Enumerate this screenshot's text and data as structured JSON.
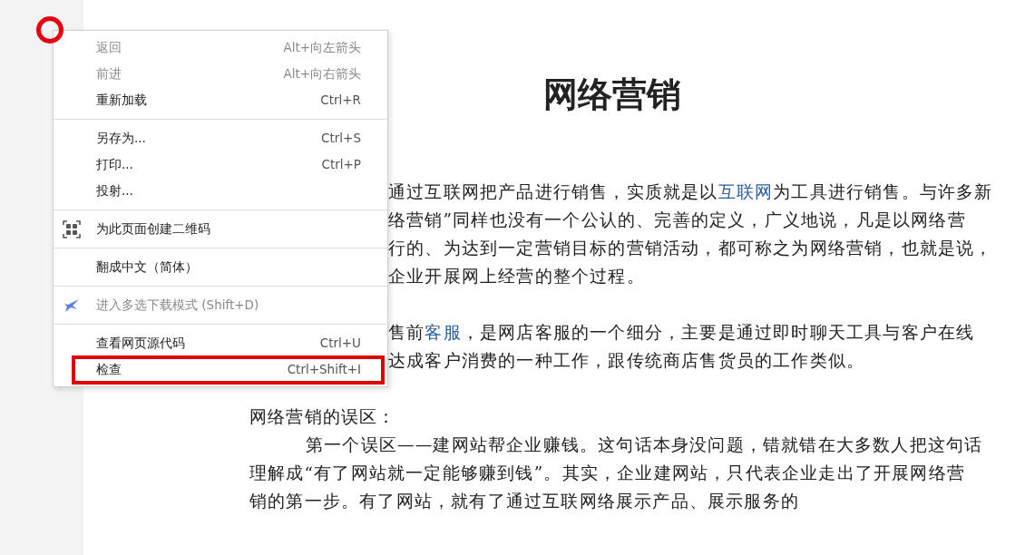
{
  "article": {
    "title": "网络营销",
    "lines": [
      {
        "kind": "clipped",
        "segments": [
          {
            "text": "通过互联网把产品进行销售，实质就是以",
            "link": false
          },
          {
            "text": "互联网",
            "link": true
          },
          {
            "text": "为工具进行销售。与许多新",
            "link": false
          }
        ]
      },
      {
        "kind": "clipped",
        "segments": [
          {
            "text": "络营销”同样也没有一个公认的、完善的定义，广义地说，凡是以网络营",
            "link": false
          }
        ]
      },
      {
        "kind": "clipped",
        "segments": [
          {
            "text": "行的、为达到一定营销目标的营销活动，都可称之为网络营销，也就是说，",
            "link": false
          }
        ]
      },
      {
        "kind": "clipped",
        "segments": [
          {
            "text": "企业开展网上经营的整个过程。",
            "link": false
          }
        ]
      },
      {
        "kind": "gap"
      },
      {
        "kind": "clipped",
        "segments": [
          {
            "text": "售前",
            "link": false
          },
          {
            "text": "客服",
            "link": true
          },
          {
            "text": "，是网店客服的一个细分，主要是通过即时聊天工具与客户在线",
            "link": false
          }
        ]
      },
      {
        "kind": "clipped",
        "segments": [
          {
            "text": "达成客户消费的一种工作，跟传统商店售货员的工作类似。",
            "link": false
          }
        ]
      },
      {
        "kind": "gap"
      },
      {
        "kind": "full",
        "segments": [
          {
            "text": "网络营销的误区：",
            "link": false
          }
        ]
      },
      {
        "kind": "indent",
        "segments": [
          {
            "text": "第一个误区——建网站帮企业赚钱。这句话本身没问题，错就错在大多数人把这句话",
            "link": false
          }
        ]
      },
      {
        "kind": "full",
        "segments": [
          {
            "text": "理解成“有了网站就一定能够赚到钱”。其实，企业建网站，只代表企业走出了开展网络营",
            "link": false
          }
        ]
      },
      {
        "kind": "full",
        "segments": [
          {
            "text": "销的第一步。有了网站，就有了通过互联网络展示产品、展示服务的",
            "link": false
          }
        ]
      }
    ]
  },
  "context_menu": {
    "click_marker": true,
    "items": [
      {
        "kind": "item",
        "label": "返回",
        "shortcut": "Alt+向左箭头",
        "disabled": true,
        "highlighted": false
      },
      {
        "kind": "item",
        "label": "前进",
        "shortcut": "Alt+向右箭头",
        "disabled": true,
        "highlighted": false
      },
      {
        "kind": "item",
        "label": "重新加载",
        "shortcut": "Ctrl+R",
        "disabled": false,
        "highlighted": false
      },
      {
        "kind": "separator"
      },
      {
        "kind": "item",
        "label": "另存为...",
        "shortcut": "Ctrl+S",
        "disabled": false,
        "highlighted": false
      },
      {
        "kind": "item",
        "label": "打印...",
        "shortcut": "Ctrl+P",
        "disabled": false,
        "highlighted": false
      },
      {
        "kind": "item",
        "label": "投射...",
        "disabled": false,
        "highlighted": false
      },
      {
        "kind": "separator"
      },
      {
        "kind": "qr_item",
        "label": "为此页面创建二维码",
        "disabled": false,
        "highlighted": false
      },
      {
        "kind": "separator"
      },
      {
        "kind": "item",
        "label": "翻成中文（简体）",
        "disabled": false,
        "highlighted": false
      },
      {
        "kind": "separator"
      },
      {
        "kind": "download_item",
        "label": "进入多选下载模式 (Shift+D)",
        "disabled": true,
        "highlighted": false
      },
      {
        "kind": "separator"
      },
      {
        "kind": "item",
        "label": "查看网页源代码",
        "shortcut": "Ctrl+U",
        "disabled": false,
        "highlighted": false
      },
      {
        "kind": "item",
        "label": "检查",
        "shortcut": "Ctrl+Shift+I",
        "disabled": false,
        "highlighted": true
      }
    ]
  }
}
